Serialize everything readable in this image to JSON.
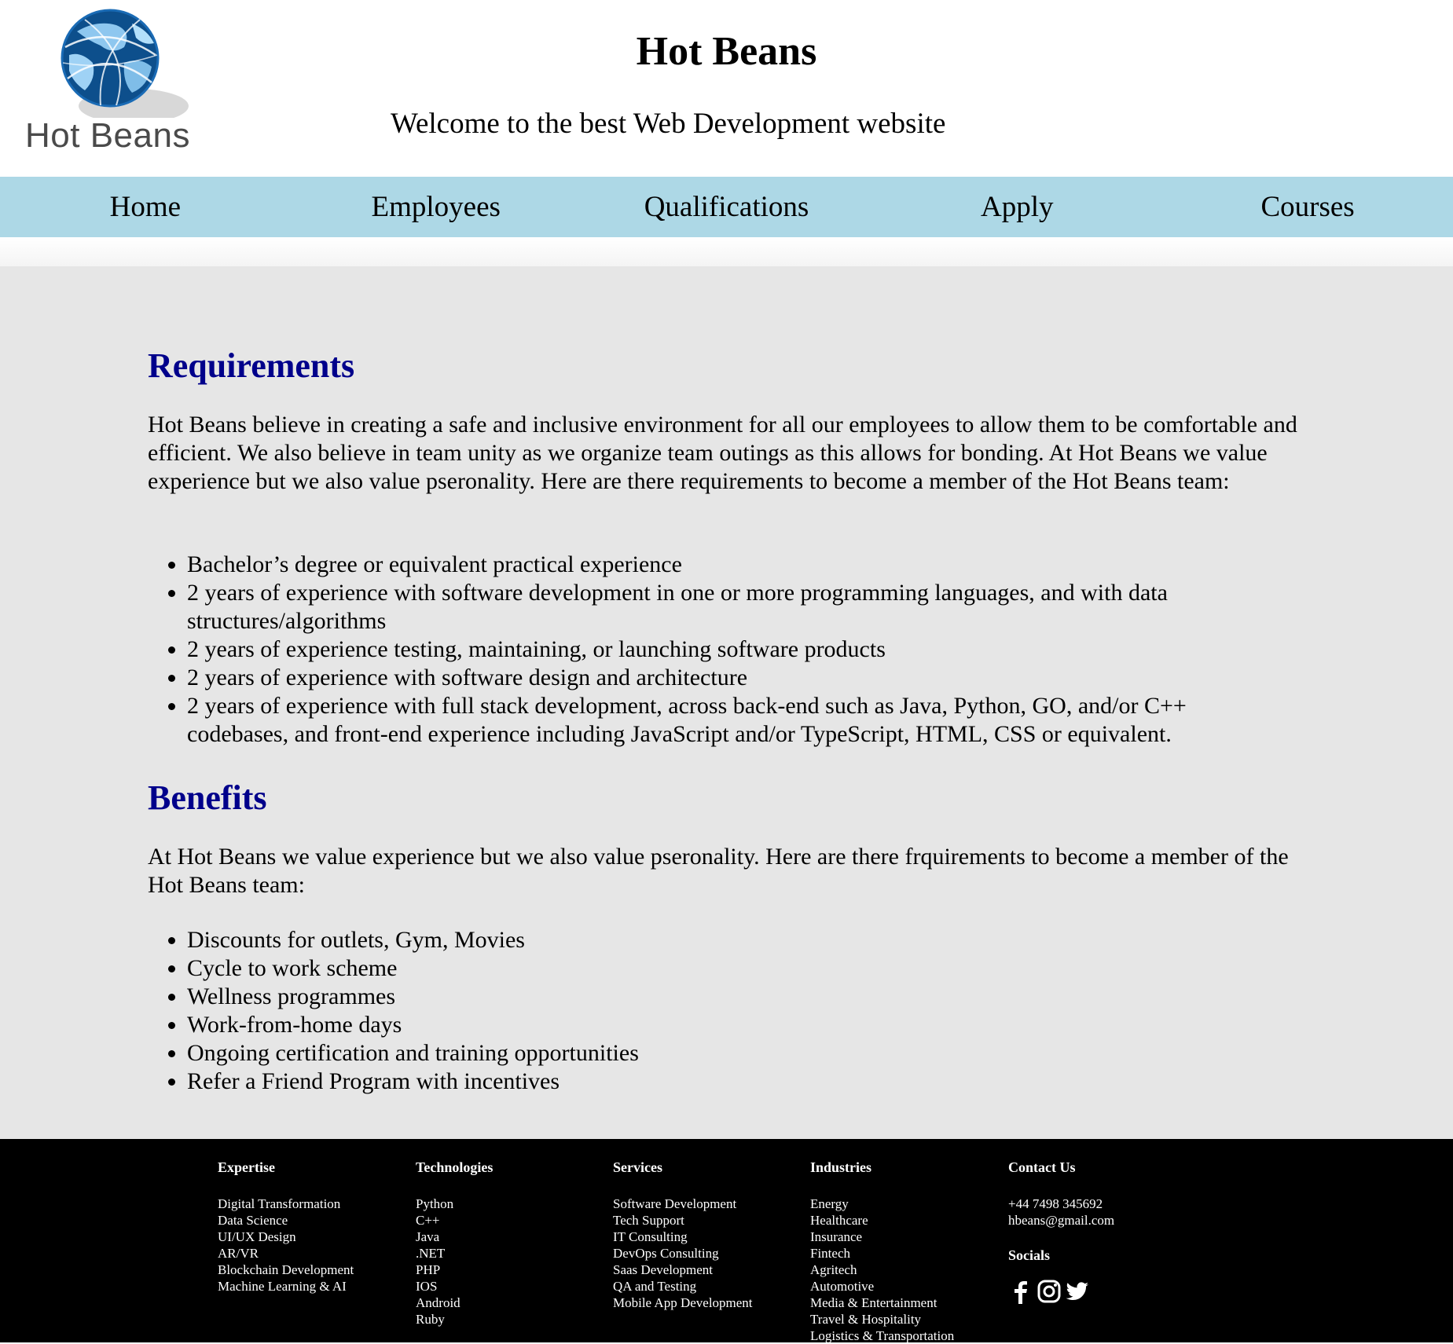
{
  "header": {
    "logo_text": "Hot Beans",
    "title": "Hot Beans",
    "subtitle": "Welcome to the best Web Development website"
  },
  "nav": {
    "items": [
      "Home",
      "Employees",
      "Qualifications",
      "Apply",
      "Courses"
    ]
  },
  "requirements": {
    "title": "Requirements",
    "intro": "Hot Beans believe in creating a safe and inclusive environment for all our employees to allow them to be comfortable and efficient. We also believe in team unity as we organize team outings as this allows for bonding. At Hot Beans we value experience but we also value pseronality. Here are there requirements to become a member of the Hot Beans team:",
    "items": [
      "Bachelor’s degree or equivalent practical experience",
      "2 years of experience with software development in one or more programming languages, and with data structures/algorithms",
      "2 years of experience testing, maintaining, or launching software products",
      "2 years of experience with software design and architecture",
      "2 years of experience with full stack development, across back-end such as Java, Python, GO, and/or C++ codebases, and front-end experience including JavaScript and/or TypeScript, HTML, CSS or equivalent."
    ]
  },
  "benefits": {
    "title": "Benefits",
    "intro": "At Hot Beans we value experience but we also value pseronality. Here are there frquirements to become a member of the Hot Beans team:",
    "items": [
      "Discounts for outlets, Gym, Movies",
      "Cycle to work scheme",
      "Wellness programmes",
      "Work-from-home days",
      "Ongoing certification and training opportunities",
      "Refer a Friend Program with incentives"
    ]
  },
  "footer": {
    "expertise": {
      "title": "Expertise",
      "items": [
        "Digital Transformation",
        "Data Science",
        "UI/UX Design",
        "AR/VR",
        "Blockchain Development",
        "Machine Learning & AI"
      ]
    },
    "technologies": {
      "title": "Technologies",
      "items": [
        "Python",
        "C++",
        "Java",
        ".NET",
        "PHP",
        "IOS",
        "Android",
        "Ruby"
      ]
    },
    "services": {
      "title": "Services",
      "items": [
        "Software Development",
        "Tech Support",
        "IT Consulting",
        "DevOps Consulting",
        "Saas Development",
        "QA and Testing",
        "Mobile App Development"
      ]
    },
    "industries": {
      "title": "Industries",
      "items": [
        "Energy",
        "Healthcare",
        "Insurance",
        "Fintech",
        "Agritech",
        "Automotive",
        "Media & Entertainment",
        "Travel & Hospitality",
        "Logistics & Transportation"
      ]
    },
    "contact": {
      "title": "Contact Us",
      "phone": "+44 7498 345692",
      "email": "hbeans@gmail.com",
      "socials_title": "Socials",
      "social_icons": [
        "facebook-icon",
        "instagram-icon",
        "twitter-icon"
      ]
    }
  },
  "colors": {
    "nav_bg": "#add8e6",
    "main_bg": "#e6e6e6",
    "heading": "#00008b",
    "footer_bg": "#000000"
  }
}
